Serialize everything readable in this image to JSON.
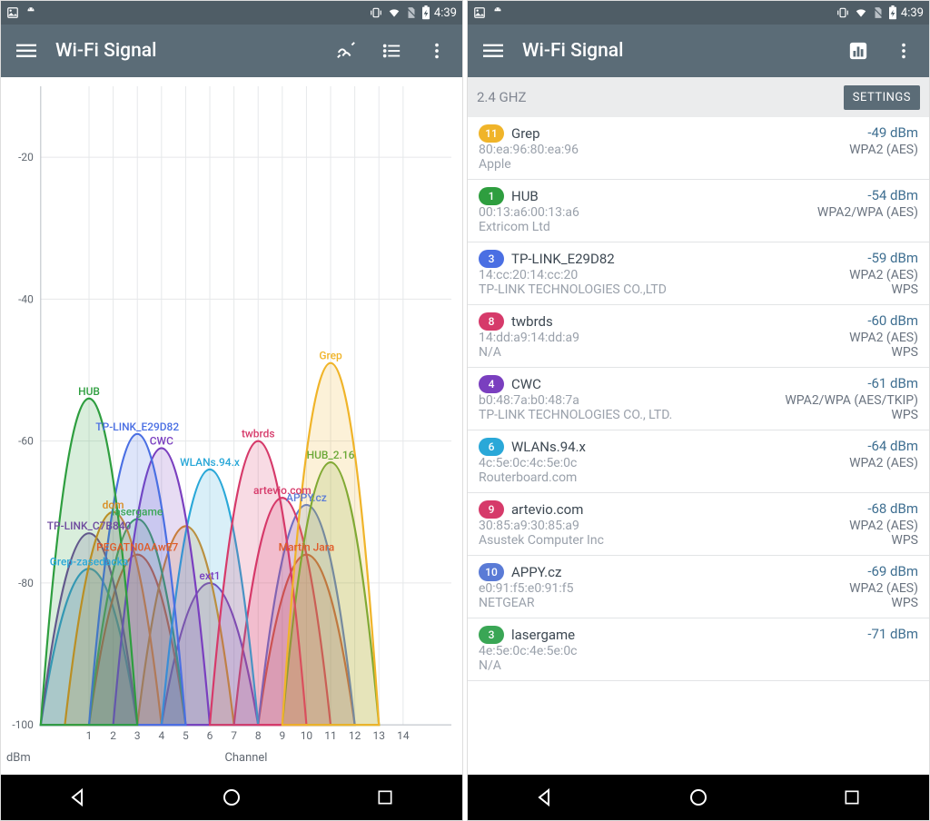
{
  "status": {
    "time": "4:39"
  },
  "app": {
    "title": "Wi-Fi Signal"
  },
  "list": {
    "band_label": "2.4 GHZ",
    "settings_label": "SETTINGS"
  },
  "chart_data": {
    "type": "area",
    "xlabel": "Channel",
    "ylabel": "dBm",
    "x_ticks": [
      1,
      2,
      3,
      4,
      5,
      6,
      7,
      8,
      9,
      10,
      11,
      12,
      13,
      14
    ],
    "y_ticks": [
      -20,
      -40,
      -60,
      -80,
      -100
    ],
    "ylim": [
      -100,
      -10
    ],
    "series": [
      {
        "name": "Grep",
        "channel": 11,
        "peak_dbm": -49,
        "color": "#f0b429"
      },
      {
        "name": "HUB",
        "channel": 1,
        "peak_dbm": -54,
        "color": "#2e9e3f"
      },
      {
        "name": "TP-LINK_E29D82",
        "channel": 3,
        "peak_dbm": -59,
        "color": "#4a6fe3"
      },
      {
        "name": "twbrds",
        "channel": 8,
        "peak_dbm": -60,
        "color": "#d63a6a"
      },
      {
        "name": "CWC",
        "channel": 4,
        "peak_dbm": -61,
        "color": "#7a3fbf"
      },
      {
        "name": "WLANs.94.x",
        "channel": 6,
        "peak_dbm": -64,
        "color": "#2aa8d8"
      },
      {
        "name": "artevio.com",
        "channel": 9,
        "peak_dbm": -68,
        "color": "#d63a6a"
      },
      {
        "name": "APPY.cz",
        "channel": 10,
        "peak_dbm": -69,
        "color": "#5a7bd6"
      },
      {
        "name": "lasergame",
        "channel": 3,
        "peak_dbm": -71,
        "color": "#3aa655"
      },
      {
        "name": "HUB_2.16",
        "channel": 11,
        "peak_dbm": -63,
        "color": "#6aa836"
      },
      {
        "name": "dom",
        "channel": 2,
        "peak_dbm": -70,
        "color": "#d98b1f"
      },
      {
        "name": "TP-LINK_C7B840",
        "channel": 1,
        "peak_dbm": -73,
        "color": "#6e4a9e"
      },
      {
        "name": "Martin Jara",
        "channel": 10,
        "peak_dbm": -76,
        "color": "#e05b2a"
      },
      {
        "name": "Grep-zasedacka",
        "channel": 1,
        "peak_dbm": -78,
        "color": "#2aa8d8"
      },
      {
        "name": "PEGATN0AAwE7",
        "channel": 3,
        "peak_dbm": -76,
        "color": "#e05b2a"
      },
      {
        "name": "ext1",
        "channel": 6,
        "peak_dbm": -80,
        "color": "#7a3fbf"
      },
      {
        "name": "artevio.com2",
        "channel": 5,
        "peak_dbm": -72,
        "color": "#d98b1f",
        "label": "artevio.com"
      }
    ]
  },
  "networks": [
    {
      "channel": "11",
      "ssid": "Grep",
      "dbm": "-49 dBm",
      "mac": "80:ea:96:80:ea:96",
      "sec": "WPA2 (AES)",
      "vendor": "Apple",
      "wps": "",
      "color": "#f0b429"
    },
    {
      "channel": "1",
      "ssid": "HUB",
      "dbm": "-54 dBm",
      "mac": "00:13:a6:00:13:a6",
      "sec": "WPA2/WPA (AES)",
      "vendor": "Extricom Ltd",
      "wps": "",
      "color": "#2e9e3f"
    },
    {
      "channel": "3",
      "ssid": "TP-LINK_E29D82",
      "dbm": "-59 dBm",
      "mac": "14:cc:20:14:cc:20",
      "sec": "WPA2 (AES)",
      "vendor": "TP-LINK TECHNOLOGIES CO.,LTD",
      "wps": "WPS",
      "color": "#4a6fe3"
    },
    {
      "channel": "8",
      "ssid": "twbrds",
      "dbm": "-60 dBm",
      "mac": "14:dd:a9:14:dd:a9",
      "sec": "WPA2 (AES)",
      "vendor": "N/A",
      "wps": "WPS",
      "color": "#d63a6a"
    },
    {
      "channel": "4",
      "ssid": "CWC",
      "dbm": "-61 dBm",
      "mac": "b0:48:7a:b0:48:7a",
      "sec": "WPA2/WPA (AES/TKIP)",
      "vendor": "TP-LINK TECHNOLOGIES CO., LTD.",
      "wps": "WPS",
      "color": "#7a3fbf"
    },
    {
      "channel": "6",
      "ssid": "WLANs.94.x",
      "dbm": "-64 dBm",
      "mac": "4c:5e:0c:4c:5e:0c",
      "sec": "WPA2 (AES)",
      "vendor": "Routerboard.com",
      "wps": "",
      "color": "#2aa8d8"
    },
    {
      "channel": "9",
      "ssid": "artevio.com",
      "dbm": "-68 dBm",
      "mac": "30:85:a9:30:85:a9",
      "sec": "WPA2 (AES)",
      "vendor": "Asustek Computer Inc",
      "wps": "WPS",
      "color": "#d63a6a"
    },
    {
      "channel": "10",
      "ssid": "APPY.cz",
      "dbm": "-69 dBm",
      "mac": "e0:91:f5:e0:91:f5",
      "sec": "WPA2 (AES)",
      "vendor": "NETGEAR",
      "wps": "WPS",
      "color": "#5a7bd6"
    },
    {
      "channel": "3",
      "ssid": "lasergame",
      "dbm": "-71 dBm",
      "mac": "4e:5e:0c:4e:5e:0c",
      "sec": "",
      "vendor": "N/A",
      "wps": "",
      "color": "#3aa655"
    }
  ]
}
